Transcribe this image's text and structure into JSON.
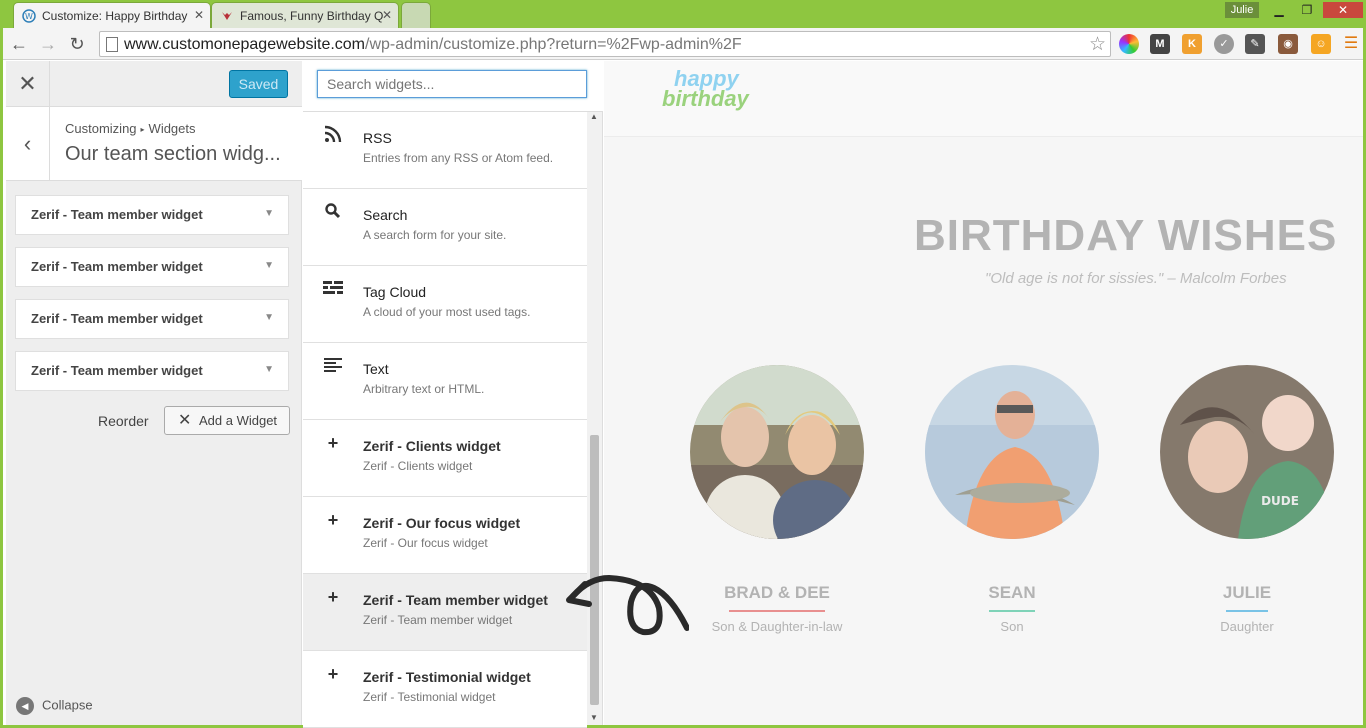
{
  "browser": {
    "tabs": [
      {
        "label": "Customize: Happy Birthday"
      },
      {
        "label": "Famous, Funny Birthday Q"
      }
    ],
    "user": "Julie",
    "url_host": "www.customonepagewebsite.com",
    "url_path": "/wp-admin/customize.php?return=%2Fwp-admin%2F"
  },
  "customizer": {
    "saved_label": "Saved",
    "breadcrumb_root": "Customizing",
    "breadcrumb_section": "Widgets",
    "section_title": "Our team section widg...",
    "widgets": [
      {
        "label": "Zerif - Team member widget"
      },
      {
        "label": "Zerif - Team member widget"
      },
      {
        "label": "Zerif - Team member widget"
      },
      {
        "label": "Zerif - Team member widget"
      }
    ],
    "reorder_label": "Reorder",
    "add_widget_label": "Add a Widget",
    "collapse_label": "Collapse"
  },
  "available_widgets": {
    "search_placeholder": "Search widgets...",
    "items": [
      {
        "title": "RSS",
        "desc": "Entries from any RSS or Atom feed.",
        "icon": "rss-icon"
      },
      {
        "title": "Search",
        "desc": "A search form for your site.",
        "icon": "search-icon"
      },
      {
        "title": "Tag Cloud",
        "desc": "A cloud of your most used tags.",
        "icon": "tag-cloud-icon"
      },
      {
        "title": "Text",
        "desc": "Arbitrary text or HTML.",
        "icon": "text-icon"
      },
      {
        "title": "Zerif - Clients widget",
        "desc": "Zerif - Clients widget",
        "icon": "plus-icon"
      },
      {
        "title": "Zerif - Our focus widget",
        "desc": "Zerif - Our focus widget",
        "icon": "plus-icon"
      },
      {
        "title": "Zerif - Team member widget",
        "desc": "Zerif - Team member widget",
        "icon": "plus-icon"
      },
      {
        "title": "Zerif - Testimonial widget",
        "desc": "Zerif - Testimonial widget",
        "icon": "plus-icon"
      }
    ]
  },
  "preview": {
    "logo_line1": "happy",
    "logo_line2": "birthday",
    "title": "BIRTHDAY WISHES",
    "quote": "\"Old age is not for sissies.\" – Malcolm Forbes",
    "members": [
      {
        "name": "BRAD & DEE",
        "role": "Son & Daughter-in-law",
        "accent": "#e88f8f"
      },
      {
        "name": "SEAN",
        "role": "Son",
        "accent": "#7fd3b8"
      },
      {
        "name": "JULIE",
        "role": "Daughter",
        "accent": "#79c3e6"
      }
    ]
  },
  "colors": {
    "saved_button": "#2ea2cc",
    "frame": "#8ec640"
  }
}
